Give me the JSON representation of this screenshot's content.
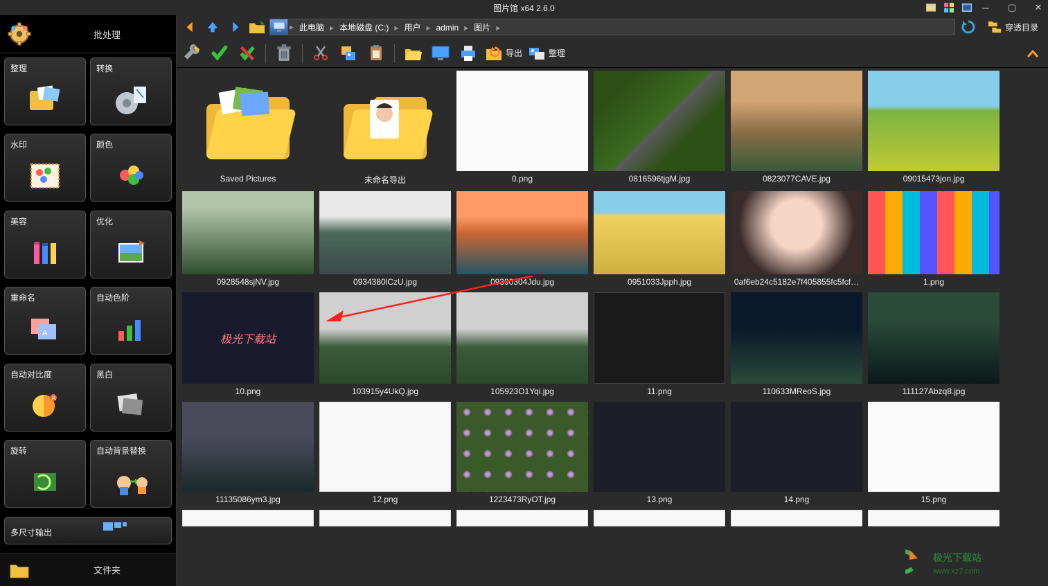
{
  "title": "图片馆 x64 2.6.0",
  "sidebar": {
    "header": "批处理",
    "footer": "文件夹",
    "tiles": [
      {
        "label": "整理"
      },
      {
        "label": "转换"
      },
      {
        "label": "水印"
      },
      {
        "label": "颜色"
      },
      {
        "label": "美容"
      },
      {
        "label": "优化"
      },
      {
        "label": "重命名"
      },
      {
        "label": "自动色阶"
      },
      {
        "label": "自动对比度"
      },
      {
        "label": "黑白"
      },
      {
        "label": "旋转"
      },
      {
        "label": "自动背景替换"
      },
      {
        "label": "多尺寸输出"
      }
    ]
  },
  "breadcrumb": [
    "此电脑",
    "本地磁盘 (C:)",
    "用户",
    "admin",
    "图片"
  ],
  "penetrate_label": "穿透目录",
  "export_label": "导出",
  "organize_label": "整理",
  "thumbs": [
    [
      {
        "label": "Saved Pictures",
        "type": "folder"
      },
      {
        "label": "未命名导出",
        "type": "folder_face"
      },
      {
        "label": "0.png",
        "cls": "ph-editor",
        "h": "row1"
      },
      {
        "label": "0816596tjgM.jpg",
        "cls": "ph-road"
      },
      {
        "label": "0823077CAVE.jpg",
        "cls": "ph-mtn"
      },
      {
        "label": "09015473jon.jpg",
        "cls": "ph-field"
      }
    ],
    [
      {
        "label": "0928548sjNV.jpg",
        "cls": "ph-forest"
      },
      {
        "label": "0934380lCzU.jpg",
        "cls": "ph-lake"
      },
      {
        "label": "09390304Jdu.jpg",
        "cls": "ph-bridge"
      },
      {
        "label": "0951033Jpph.jpg",
        "cls": "ph-yellow"
      },
      {
        "label": "0af6eb24c5182e7f405855fc5fcf…",
        "cls": "ph-face"
      },
      {
        "label": "1.png",
        "cls": "ph-tiles"
      }
    ],
    [
      {
        "label": "10.png",
        "cls": "ph-dark",
        "overlay": "极光下载站"
      },
      {
        "label": "103915y4UkQ.jpg",
        "cls": "ph-hill"
      },
      {
        "label": "105923O1Yqi.jpg",
        "cls": "ph-hill"
      },
      {
        "label": "11.png",
        "cls": "ph-wire"
      },
      {
        "label": "110633MReoS.jpg",
        "cls": "ph-night"
      },
      {
        "label": "111127Abzq8.jpg",
        "cls": "ph-aurora"
      }
    ],
    [
      {
        "label": "11135086ym3.jpg",
        "cls": "ph-storm"
      },
      {
        "label": "12.png",
        "cls": "ph-white"
      },
      {
        "label": "1223473RyOT.jpg",
        "cls": "ph-flower"
      },
      {
        "label": "13.png",
        "cls": "ph-dkw"
      },
      {
        "label": "14.png",
        "cls": "ph-dkw"
      },
      {
        "label": "15.png",
        "cls": "ph-editor"
      }
    ]
  ],
  "watermark": "极光下载站  www.xz7.com"
}
